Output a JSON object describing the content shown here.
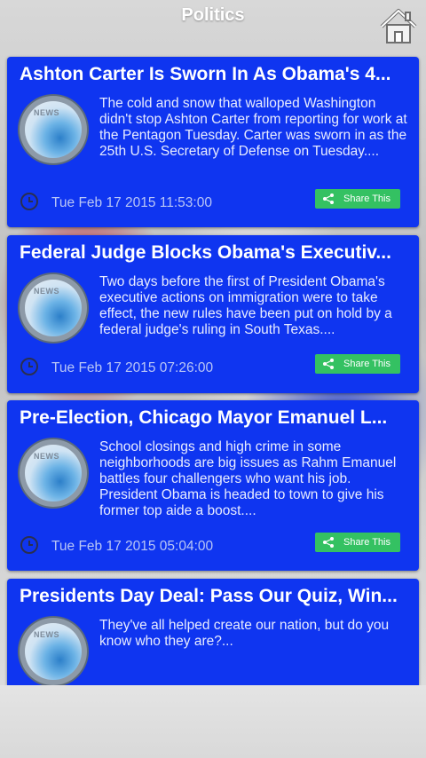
{
  "header": {
    "title": "Politics",
    "home_icon": "home-icon"
  },
  "articles": [
    {
      "title": "Ashton Carter Is Sworn In As Obama's 4...",
      "thumb_label": "NEWS",
      "summary": "The cold and snow that walloped Washington didn't stop Ashton Carter from reporting for work at the Pentagon Tuesday. Carter was sworn in as the 25th U.S. Secretary of Defense on Tuesday....",
      "date": "Tue Feb 17 2015 11:53:00",
      "share_label": "Share This"
    },
    {
      "title": "Federal Judge Blocks Obama's Executiv...",
      "thumb_label": "NEWS",
      "summary": "Two days before the first of President Obama's executive actions on immigration were to take effect, the new rules have been put on hold by a federal judge's ruling in South Texas....",
      "date": "Tue Feb 17 2015 07:26:00",
      "share_label": "Share This"
    },
    {
      "title": "Pre-Election, Chicago Mayor Emanuel L...",
      "thumb_label": "NEWS",
      "summary": "School closings and high crime in some neighborhoods are big issues as Rahm Emanuel battles four challengers who want his job. President Obama is headed to town to give his former top aide a boost....",
      "date": "Tue Feb 17 2015 05:04:00",
      "share_label": "Share This"
    },
    {
      "title": "Presidents Day Deal: Pass Our Quiz, Win...",
      "thumb_label": "NEWS",
      "summary": "They've all helped create our nation, but do you know who they are?...",
      "date": "",
      "share_label": ""
    }
  ],
  "colors": {
    "card_bg": "#0f35f0",
    "share_bg": "#34c162",
    "date_text": "#b9c6f6"
  }
}
